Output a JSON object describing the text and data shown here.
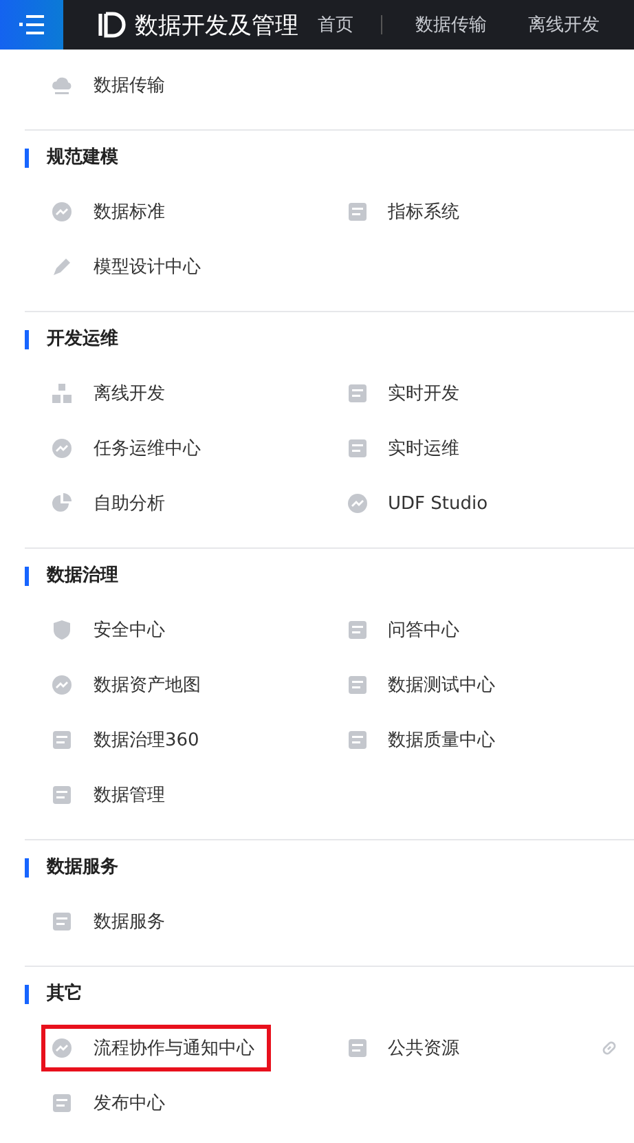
{
  "top_bar": {
    "title": "数据开发及管理",
    "nav": [
      "首页",
      "数据传输",
      "离线开发"
    ]
  },
  "sections": [
    {
      "items": [
        {
          "label": "数据传输"
        }
      ]
    },
    {
      "title": "规范建模",
      "items": [
        {
          "label": "数据标准"
        },
        {
          "label": "指标系统"
        },
        {
          "label": "模型设计中心"
        }
      ]
    },
    {
      "title": "开发运维",
      "items": [
        {
          "label": "离线开发"
        },
        {
          "label": "实时开发"
        },
        {
          "label": "任务运维中心"
        },
        {
          "label": "实时运维"
        },
        {
          "label": "自助分析"
        },
        {
          "label": "UDF Studio"
        }
      ]
    },
    {
      "title": "数据治理",
      "items": [
        {
          "label": "安全中心"
        },
        {
          "label": "问答中心"
        },
        {
          "label": "数据资产地图"
        },
        {
          "label": "数据测试中心"
        },
        {
          "label": "数据治理360"
        },
        {
          "label": "数据质量中心"
        },
        {
          "label": "数据管理"
        }
      ]
    },
    {
      "title": "数据服务",
      "items": [
        {
          "label": "数据服务"
        }
      ]
    },
    {
      "title": "其它",
      "items": [
        {
          "label": "流程协作与通知中心",
          "highlighted": true
        },
        {
          "label": "公共资源",
          "link": true
        },
        {
          "label": "发布中心"
        }
      ]
    }
  ]
}
